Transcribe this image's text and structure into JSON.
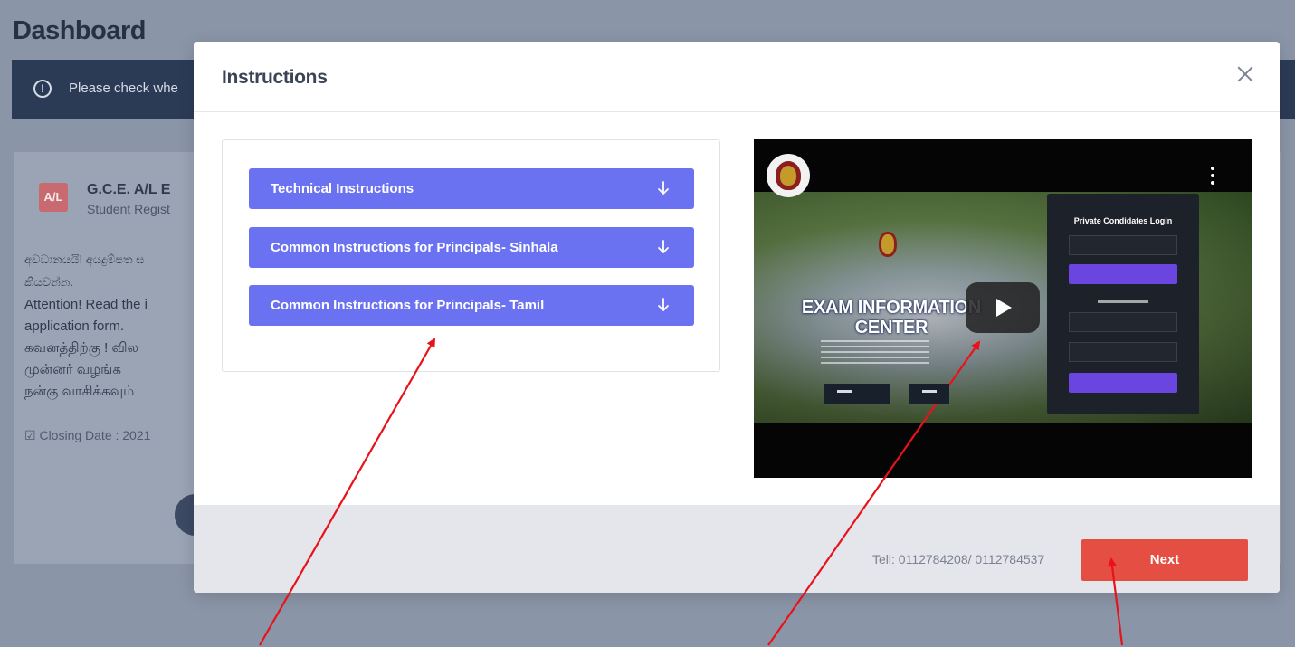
{
  "background": {
    "title": "Dashboard",
    "alert": "Please check whe",
    "card": {
      "badge": "A/L",
      "exam_title": "G.C.E. A/L E",
      "exam_sub": "Student Regist",
      "lines": [
        "අවධානයයි! අයදුම්පත ස",
        "කියවන්න.",
        "Attention! Read the i",
        "application form.",
        "கவனத்திற்கு ! வில",
        "முன்னர் வழங்க",
        "நன்கு வாசிக்கவும்"
      ],
      "closing": "Closing Date : 2021"
    }
  },
  "modal": {
    "title": "Instructions",
    "accordion": [
      {
        "label": "Technical Instructions"
      },
      {
        "label": "Common Instructions for Principals- Sinhala"
      },
      {
        "label": "Common Instructions for Principals- Tamil"
      }
    ],
    "video": {
      "headline": "EXAM INFORMATION CENTER",
      "panel_title": "Private Condidates Login"
    },
    "footer": {
      "tel": "Tell: 0112784208/ 0112784537",
      "next_label": "Next"
    }
  },
  "colors": {
    "accordion": "#6a72f2",
    "next_button": "#e54e43",
    "annotation_arrow": "#e8121a",
    "overlay": "#8a95a7"
  },
  "icons": {
    "close": "close-icon",
    "arrow": "arrow-down-icon",
    "info": "info-icon",
    "play": "play-icon"
  }
}
